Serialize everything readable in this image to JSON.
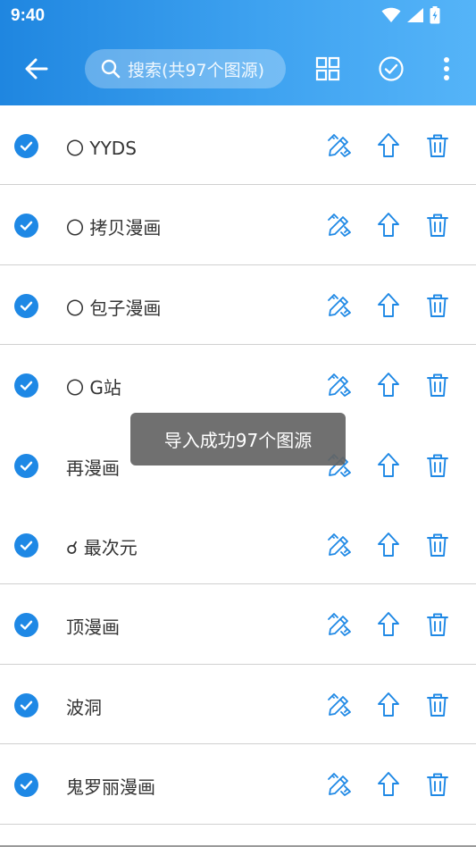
{
  "status_bar": {
    "time": "9:40"
  },
  "toolbar": {
    "search_placeholder": "搜索(共97个图源)",
    "icons": [
      "arrow-back-icon",
      "search-icon",
      "grid-view-icon",
      "check-circle-icon",
      "more-vert-icon"
    ]
  },
  "items": [
    {
      "name": "〇 YYDS",
      "checked": true
    },
    {
      "name": "〇 拷贝漫画",
      "checked": true
    },
    {
      "name": "〇 包子漫画",
      "checked": true
    },
    {
      "name": "〇 G站",
      "checked": true
    },
    {
      "name": "再漫画",
      "checked": true
    },
    {
      "name": "☌ 最次元",
      "checked": true
    },
    {
      "name": "顶漫画",
      "checked": true
    },
    {
      "name": "波洞",
      "checked": true
    },
    {
      "name": "鬼罗丽漫画",
      "checked": true
    }
  ],
  "row_action_icons": [
    "edit-icon",
    "upload-icon",
    "delete-icon"
  ],
  "toast": {
    "message": "导入成功97个图源"
  },
  "colors": {
    "appbar": "#2b93e8",
    "accent": "#1e88e5",
    "icon": "#1e88e5",
    "toast_bg": "#646464"
  }
}
